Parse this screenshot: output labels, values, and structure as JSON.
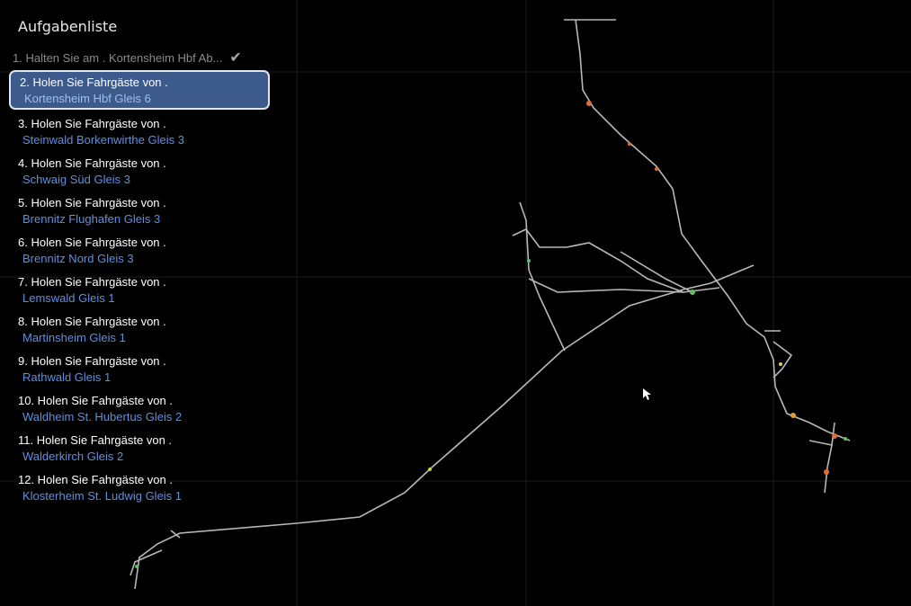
{
  "panel_title": "Aufgabenliste",
  "tasks": [
    {
      "label": "1. Halten Sie am . Kortensheim Hbf Ab...",
      "status": "done",
      "icon": "checkmark-icon",
      "check": "✔"
    },
    {
      "label": "2. Holen Sie Fahrgäste von  .",
      "station": "Kortensheim Hbf Gleis 6",
      "status": "active"
    },
    {
      "label": "3. Holen Sie Fahrgäste von  .",
      "station": "Steinwald Borkenwirthe Gleis 3"
    },
    {
      "label": "4. Holen Sie Fahrgäste von  .",
      "station": "Schwaig Süd Gleis 3"
    },
    {
      "label": "5. Holen Sie Fahrgäste von  .",
      "station": "Brennitz Flughafen Gleis 3"
    },
    {
      "label": "6. Holen Sie Fahrgäste von  .",
      "station": "Brennitz Nord Gleis 3"
    },
    {
      "label": "7. Holen Sie Fahrgäste von  .",
      "station": "Lemswald Gleis 1"
    },
    {
      "label": "8. Holen Sie Fahrgäste von  .",
      "station": "Martinsheim Gleis 1"
    },
    {
      "label": "9. Holen Sie Fahrgäste von  .",
      "station": "Rathwald Gleis 1"
    },
    {
      "label": "10. Holen Sie Fahrgäste von  .",
      "station": "Waldheim St. Hubertus Gleis 2"
    },
    {
      "label": "11. Holen Sie Fahrgäste von  .",
      "station": "Walderkirch Gleis 2"
    },
    {
      "label": "12. Holen Sie Fahrgäste von  .",
      "station": "Klosterheim St. Ludwig Gleis 1"
    }
  ],
  "colors": {
    "active_bg": "#3d5a8c",
    "station_text": "#5f8fe0",
    "track": "#b8b8b8"
  }
}
